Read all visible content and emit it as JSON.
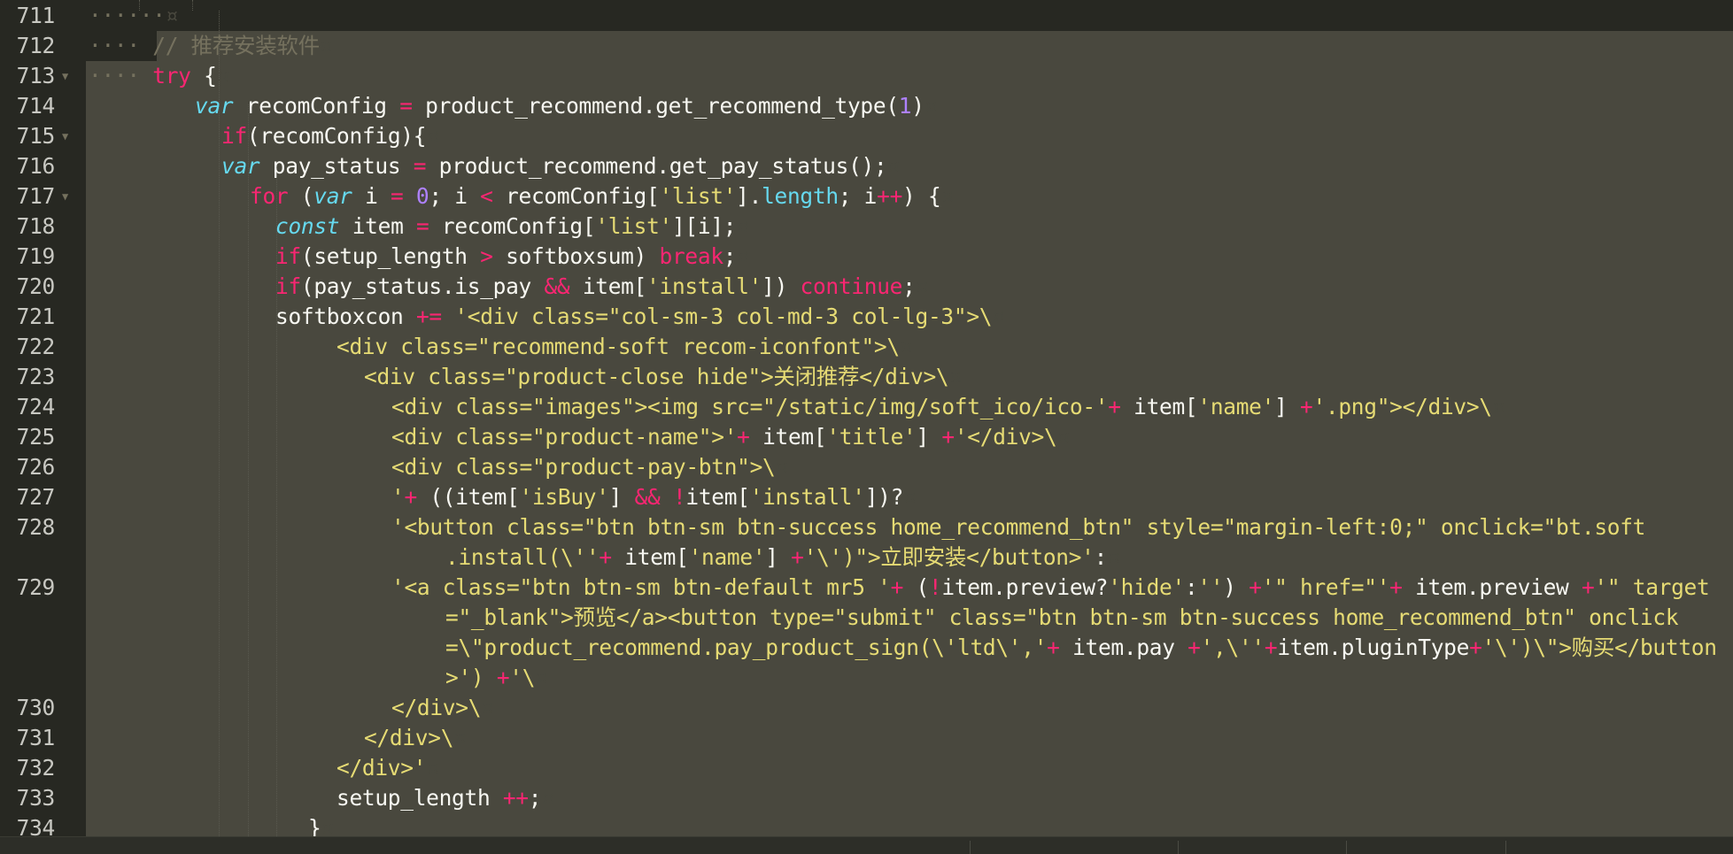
{
  "editor": {
    "colors": {
      "background": "#272822",
      "selection": "#49483e",
      "keyword": "#f92672",
      "string": "#e6db74",
      "number": "#ae81ff",
      "storage": "#66d9ef",
      "comment": "#75715e",
      "text": "#f8f8f2"
    },
    "fold_marker_icon": "triangle-down-icon",
    "line_end_marker_icon": "pilcrow-icon",
    "lines": [
      {
        "num": "711",
        "indent": "······",
        "fold": false,
        "tokens": [],
        "pil": true,
        "cont": []
      },
      {
        "num": "712",
        "indent": "····",
        "fold": false,
        "tokens": [
          {
            "t": "c",
            "v": "// 推荐安装软件"
          }
        ],
        "pil": true,
        "cont": []
      },
      {
        "num": "713",
        "indent": "····",
        "fold": true,
        "tokens": [
          {
            "t": "k",
            "v": "try"
          },
          {
            "t": "t",
            "v": " {"
          }
        ],
        "pil": true,
        "cont": []
      },
      {
        "num": "714",
        "indent": "",
        "fold": false,
        "tokens": [
          {
            "t": "st",
            "v": "var"
          },
          {
            "t": "t",
            "v": " recomConfig "
          },
          {
            "t": "k",
            "v": "="
          },
          {
            "t": "t",
            "v": " product_recommend.get_recommend_type("
          },
          {
            "t": "n",
            "v": "1"
          },
          {
            "t": "t",
            "v": ")"
          }
        ],
        "pil": true,
        "cont": []
      },
      {
        "num": "715",
        "indent": "",
        "fold": true,
        "tokens": [
          {
            "t": "k",
            "v": "if"
          },
          {
            "t": "t",
            "v": "(recomConfig){"
          }
        ],
        "pil": true,
        "cont": []
      },
      {
        "num": "716",
        "indent": "",
        "fold": false,
        "tokens": [
          {
            "t": "st",
            "v": "var"
          },
          {
            "t": "t",
            "v": " pay_status "
          },
          {
            "t": "k",
            "v": "="
          },
          {
            "t": "t",
            "v": " product_recommend.get_pay_status();"
          }
        ],
        "pil": true,
        "cont": []
      },
      {
        "num": "717",
        "indent": "",
        "fold": true,
        "tokens": [
          {
            "t": "k",
            "v": "for"
          },
          {
            "t": "t",
            "v": " ("
          },
          {
            "t": "st",
            "v": "var"
          },
          {
            "t": "t",
            "v": " i "
          },
          {
            "t": "k",
            "v": "="
          },
          {
            "t": "t",
            "v": " "
          },
          {
            "t": "n",
            "v": "0"
          },
          {
            "t": "t",
            "v": "; i "
          },
          {
            "t": "k",
            "v": "<"
          },
          {
            "t": "t",
            "v": " recomConfig["
          },
          {
            "t": "s",
            "v": "'list'"
          },
          {
            "t": "t",
            "v": "]."
          },
          {
            "t": "sp",
            "v": "length"
          },
          {
            "t": "t",
            "v": "; i"
          },
          {
            "t": "k",
            "v": "++"
          },
          {
            "t": "t",
            "v": ") {"
          }
        ],
        "pil": true,
        "cont": []
      },
      {
        "num": "718",
        "indent": "",
        "fold": false,
        "tokens": [
          {
            "t": "st",
            "v": "const"
          },
          {
            "t": "t",
            "v": " item "
          },
          {
            "t": "k",
            "v": "="
          },
          {
            "t": "t",
            "v": " recomConfig["
          },
          {
            "t": "s",
            "v": "'list'"
          },
          {
            "t": "t",
            "v": "][i];"
          }
        ],
        "pil": true,
        "cont": []
      },
      {
        "num": "719",
        "indent": "",
        "fold": false,
        "tokens": [
          {
            "t": "k",
            "v": "if"
          },
          {
            "t": "t",
            "v": "(setup_length "
          },
          {
            "t": "k",
            "v": ">"
          },
          {
            "t": "t",
            "v": " softboxsum) "
          },
          {
            "t": "k",
            "v": "break"
          },
          {
            "t": "t",
            "v": ";"
          }
        ],
        "pil": true,
        "cont": []
      },
      {
        "num": "720",
        "indent": "",
        "fold": false,
        "tokens": [
          {
            "t": "k",
            "v": "if"
          },
          {
            "t": "t",
            "v": "(pay_status.is_pay "
          },
          {
            "t": "k",
            "v": "&&"
          },
          {
            "t": "t",
            "v": " item["
          },
          {
            "t": "s",
            "v": "'install'"
          },
          {
            "t": "t",
            "v": "]) "
          },
          {
            "t": "k",
            "v": "continue"
          },
          {
            "t": "t",
            "v": ";"
          }
        ],
        "pil": true,
        "cont": []
      },
      {
        "num": "721",
        "indent": "",
        "fold": false,
        "tokens": [
          {
            "t": "t",
            "v": "softboxcon "
          },
          {
            "t": "k",
            "v": "+="
          },
          {
            "t": "t",
            "v": " "
          },
          {
            "t": "s",
            "v": "'<div class=\"col-sm-3 col-md-3 col-lg-3\">\\"
          }
        ],
        "pil": true,
        "cont": []
      },
      {
        "num": "722",
        "indent": "",
        "fold": false,
        "tokens": [
          {
            "t": "s",
            "v": "<div class=\"recommend-soft recom-iconfont\">\\"
          }
        ],
        "pil": true,
        "cont": []
      },
      {
        "num": "723",
        "indent": "",
        "fold": false,
        "tokens": [
          {
            "t": "s",
            "v": "<div class=\"product-close hide\">关闭推荐</div>\\"
          }
        ],
        "pil": true,
        "cont": []
      },
      {
        "num": "724",
        "indent": "",
        "fold": false,
        "tokens": [
          {
            "t": "s",
            "v": "<div class=\"images\"><img src=\"/static/img/soft_ico/ico-'"
          },
          {
            "t": "k",
            "v": "+"
          },
          {
            "t": "t",
            "v": " item["
          },
          {
            "t": "s",
            "v": "'name'"
          },
          {
            "t": "t",
            "v": "] "
          },
          {
            "t": "k",
            "v": "+"
          },
          {
            "t": "s",
            "v": "'.png\"></div>\\"
          }
        ],
        "pil": true,
        "cont": []
      },
      {
        "num": "725",
        "indent": "",
        "fold": false,
        "tokens": [
          {
            "t": "s",
            "v": "<div class=\"product-name\">'"
          },
          {
            "t": "k",
            "v": "+"
          },
          {
            "t": "t",
            "v": " item["
          },
          {
            "t": "s",
            "v": "'title'"
          },
          {
            "t": "t",
            "v": "] "
          },
          {
            "t": "k",
            "v": "+"
          },
          {
            "t": "s",
            "v": "'</div>\\"
          }
        ],
        "pil": true,
        "cont": []
      },
      {
        "num": "726",
        "indent": "",
        "fold": false,
        "tokens": [
          {
            "t": "s",
            "v": "<div class=\"product-pay-btn\">\\"
          }
        ],
        "pil": true,
        "cont": []
      },
      {
        "num": "727",
        "indent": "",
        "fold": false,
        "tokens": [
          {
            "t": "s",
            "v": "'"
          },
          {
            "t": "k",
            "v": "+"
          },
          {
            "t": "t",
            "v": " ((item["
          },
          {
            "t": "s",
            "v": "'isBuy'"
          },
          {
            "t": "t",
            "v": "] "
          },
          {
            "t": "k",
            "v": "&&"
          },
          {
            "t": "t",
            "v": " "
          },
          {
            "t": "k",
            "v": "!"
          },
          {
            "t": "t",
            "v": "item["
          },
          {
            "t": "s",
            "v": "'install'"
          },
          {
            "t": "t",
            "v": "])?"
          }
        ],
        "pil": true,
        "cont": []
      },
      {
        "num": "728",
        "indent": "",
        "fold": false,
        "tokens": [
          {
            "t": "s",
            "v": "'<button class=\"btn btn-sm btn-success home_recommend_btn\" style=\"margin-left:0;\" onclick=\"bt.soft"
          }
        ],
        "pil": false,
        "cont": [
          [
            {
              "t": "s",
              "v": ".install(\\''"
            },
            {
              "t": "k",
              "v": "+"
            },
            {
              "t": "t",
              "v": " item["
            },
            {
              "t": "s",
              "v": "'name'"
            },
            {
              "t": "t",
              "v": "] "
            },
            {
              "t": "k",
              "v": "+"
            },
            {
              "t": "s",
              "v": "'\\')\">立即安装</button>'"
            },
            {
              "t": "t",
              "v": ":"
            }
          ]
        ]
      },
      {
        "num": "729",
        "indent": "",
        "fold": false,
        "tokens": [
          {
            "t": "s",
            "v": "'<a class=\"btn btn-sm btn-default mr5 '"
          },
          {
            "t": "k",
            "v": "+"
          },
          {
            "t": "t",
            "v": " ("
          },
          {
            "t": "k",
            "v": "!"
          },
          {
            "t": "t",
            "v": "item.preview?"
          },
          {
            "t": "s",
            "v": "'hide'"
          },
          {
            "t": "t",
            "v": ":"
          },
          {
            "t": "s",
            "v": "''"
          },
          {
            "t": "t",
            "v": ") "
          },
          {
            "t": "k",
            "v": "+"
          },
          {
            "t": "s",
            "v": "'\" href=\"'"
          },
          {
            "t": "k",
            "v": "+"
          },
          {
            "t": "t",
            "v": " item.preview "
          },
          {
            "t": "k",
            "v": "+"
          },
          {
            "t": "s",
            "v": "'\" target"
          }
        ],
        "pil": false,
        "cont": [
          [
            {
              "t": "s",
              "v": "=\"_blank\">预览</a><button type=\"submit\" class=\"btn btn-sm btn-success home_recommend_btn\" onclick"
            }
          ],
          [
            {
              "t": "s",
              "v": "=\\\"product_recommend.pay_product_sign(\\'ltd\\','"
            },
            {
              "t": "k",
              "v": "+"
            },
            {
              "t": "t",
              "v": " item.pay "
            },
            {
              "t": "k",
              "v": "+"
            },
            {
              "t": "s",
              "v": "',\\''"
            },
            {
              "t": "k",
              "v": "+"
            },
            {
              "t": "t",
              "v": "item.pluginType"
            },
            {
              "t": "k",
              "v": "+"
            },
            {
              "t": "s",
              "v": "'\\')\\\">购买</button"
            }
          ],
          [
            {
              "t": "s",
              "v": ">')"
            },
            {
              "t": "t",
              "v": " "
            },
            {
              "t": "k",
              "v": "+"
            },
            {
              "t": "s",
              "v": "'\\"
            }
          ]
        ]
      },
      {
        "num": "730",
        "indent": "",
        "fold": false,
        "tokens": [
          {
            "t": "s",
            "v": "</div>\\"
          }
        ],
        "pil": true,
        "cont": []
      },
      {
        "num": "731",
        "indent": "",
        "fold": false,
        "tokens": [
          {
            "t": "s",
            "v": "</div>\\"
          }
        ],
        "pil": true,
        "cont": []
      },
      {
        "num": "732",
        "indent": "",
        "fold": false,
        "tokens": [
          {
            "t": "s",
            "v": "</div>'"
          }
        ],
        "pil": true,
        "cont": []
      },
      {
        "num": "733",
        "indent": "",
        "fold": false,
        "tokens": [
          {
            "t": "t",
            "v": "setup_length "
          },
          {
            "t": "k",
            "v": "++"
          },
          {
            "t": "t",
            "v": ";"
          }
        ],
        "pil": true,
        "cont": []
      },
      {
        "num": "734",
        "indent": "",
        "fold": false,
        "tokens": [
          {
            "t": "t",
            "v": "}"
          }
        ],
        "pil": true,
        "cont": []
      }
    ]
  }
}
